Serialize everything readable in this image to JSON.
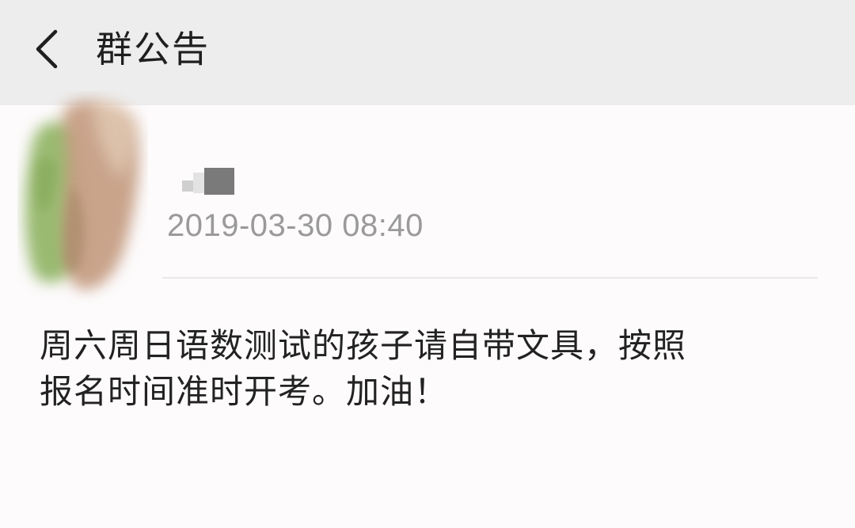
{
  "header": {
    "title": "群公告",
    "back_icon": "chevron-left-icon",
    "background": "#ededed"
  },
  "announcement": {
    "author_name": "",
    "timestamp": "2019-03-30 08:40",
    "body_lines": [
      "周六周日语数测试的孩子请自带文具，按照",
      "报名时间准时开考。加油！"
    ]
  },
  "colors": {
    "page_background": "#fdfbfc",
    "text_primary": "#222222",
    "text_secondary": "#9a9a9a",
    "divider": "#ebe8e9"
  }
}
